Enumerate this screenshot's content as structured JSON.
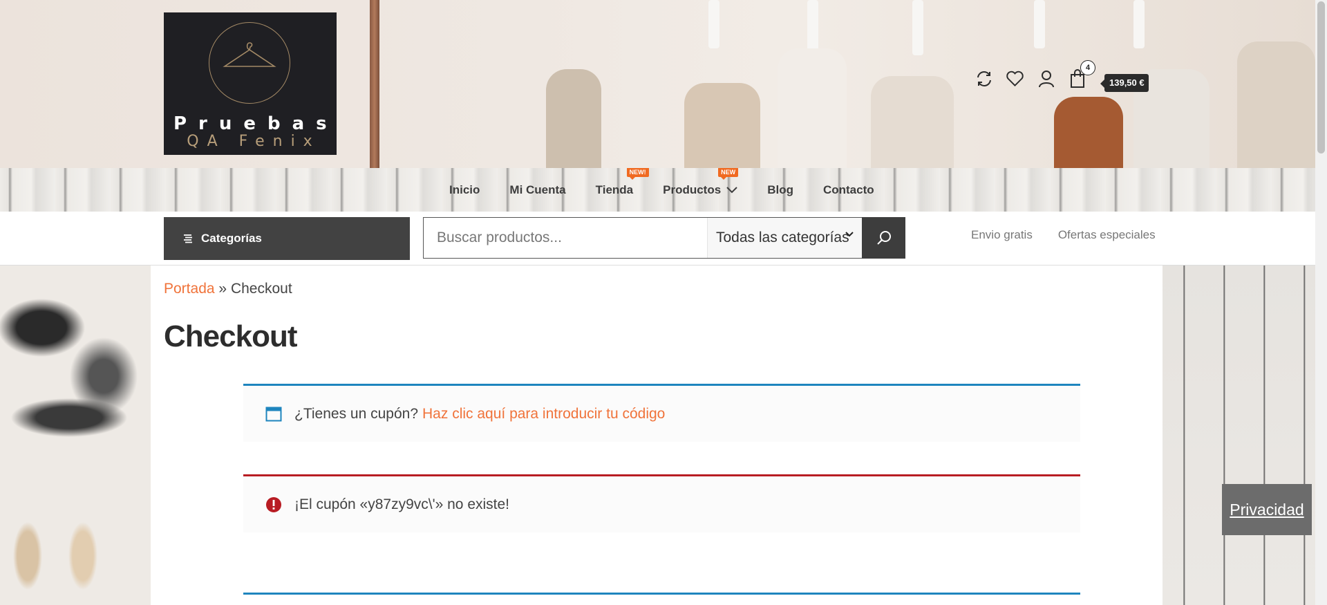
{
  "logo": {
    "line1": "Pruebas",
    "line2": "QA Fenix"
  },
  "header": {
    "cart_count": "4",
    "cart_total": "139,50 €"
  },
  "nav": {
    "items": [
      {
        "label": "Inicio"
      },
      {
        "label": "Mi Cuenta"
      },
      {
        "label": "Tienda",
        "badge": "NEW!"
      },
      {
        "label": "Productos",
        "badge": "NEW"
      },
      {
        "label": "Blog"
      },
      {
        "label": "Contacto"
      }
    ]
  },
  "search": {
    "categories_label": "Categorías",
    "placeholder": "Buscar productos...",
    "category_selected": "Todas las categorías",
    "links": [
      "Envio gratis",
      "Ofertas especiales"
    ]
  },
  "breadcrumb": {
    "home": "Portada",
    "sep": "»",
    "current": "Checkout"
  },
  "page": {
    "title": "Checkout"
  },
  "notices": {
    "coupon_text": "¿Tienes un cupón?",
    "coupon_link": "Haz clic aquí para introducir tu código",
    "error_text": "¡El cupón «y87zy9vc\\'» no existe!"
  },
  "privacy_label": "Privacidad",
  "colors": {
    "accent": "#f0733a",
    "info": "#1e85be",
    "error": "#b81c23",
    "badge": "#f06a21"
  }
}
